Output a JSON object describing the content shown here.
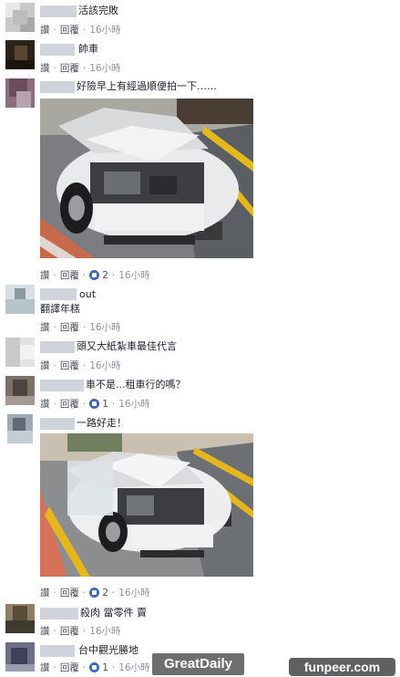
{
  "labels": {
    "like": "讚",
    "reply": "回覆",
    "dot": "·"
  },
  "comments": [
    {
      "text": "活該完敗",
      "time": "16小時"
    },
    {
      "text": "帥車",
      "time": "16小時"
    },
    {
      "text": "好險早上有經過順便拍一下……",
      "time": "16小時",
      "likes": "2"
    },
    {
      "text": "out",
      "text2": "翻譯年糕",
      "time": "16小時"
    },
    {
      "text": "頭又大紙紮車最佳代言",
      "time": "16小時"
    },
    {
      "text": "車不是...租車行的嗎？",
      "time": "16小時",
      "likes": "1"
    },
    {
      "text": "一路好走！",
      "time": "16小時",
      "likes": "2"
    },
    {
      "text": "殺肉 當零件 賣",
      "time": "16小時"
    },
    {
      "text": "台中觀光勝地",
      "time": "16小時",
      "likes": "1"
    }
  ],
  "watermarks": {
    "left": "GreatDaily",
    "right": "funpeer.com"
  }
}
